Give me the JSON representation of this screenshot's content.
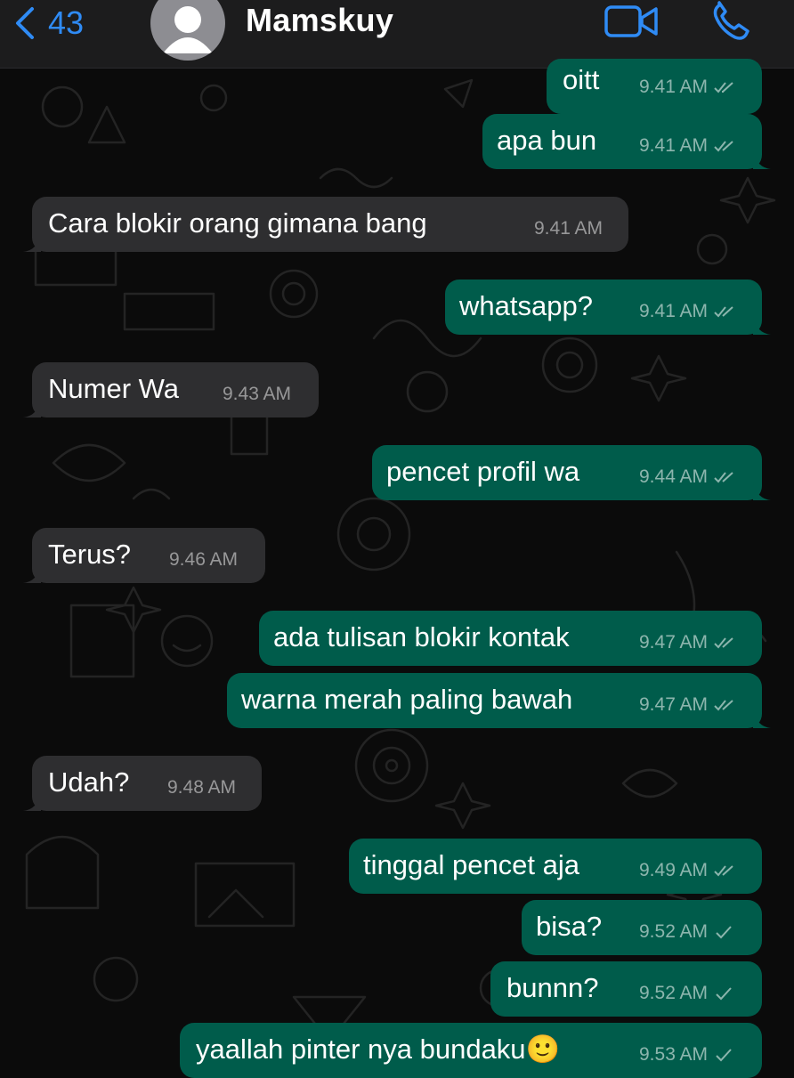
{
  "header": {
    "back_count": "43",
    "contact_name": "Mamskuy"
  },
  "messages": [
    {
      "text": "oitt",
      "time": "9.41 AM",
      "dir": "out",
      "status": "read"
    },
    {
      "text": "apa bun",
      "time": "9.41 AM",
      "dir": "out",
      "status": "read"
    },
    {
      "text": "Cara blokir orang gimana bang",
      "time": "9.41 AM",
      "dir": "in"
    },
    {
      "text": "whatsapp?",
      "time": "9.41 AM",
      "dir": "out",
      "status": "read"
    },
    {
      "text": "Numer Wa",
      "time": "9.43 AM",
      "dir": "in"
    },
    {
      "text": "pencet profil wa",
      "time": "9.44 AM",
      "dir": "out",
      "status": "read"
    },
    {
      "text": "Terus?",
      "time": "9.46 AM",
      "dir": "in"
    },
    {
      "text": "ada tulisan blokir kontak",
      "time": "9.47 AM",
      "dir": "out",
      "status": "read"
    },
    {
      "text": "warna merah paling bawah",
      "time": "9.47 AM",
      "dir": "out",
      "status": "read"
    },
    {
      "text": "Udah?",
      "time": "9.48 AM",
      "dir": "in"
    },
    {
      "text": "tinggal pencet aja",
      "time": "9.49 AM",
      "dir": "out",
      "status": "read"
    },
    {
      "text": "bisa?",
      "time": "9.52 AM",
      "dir": "out",
      "status": "sent"
    },
    {
      "text": "bunnn?",
      "time": "9.52 AM",
      "dir": "out",
      "status": "sent"
    },
    {
      "text": "yaallah pinter nya bundaku🙂",
      "time": "9.53 AM",
      "dir": "out",
      "status": "sent"
    }
  ],
  "colors": {
    "accent": "#2f8bf5",
    "outgoing_bubble": "#005c4b",
    "incoming_bubble": "#2e2e30",
    "header": "#1c1c1d"
  },
  "icons": [
    "chevron-left-icon",
    "avatar-placeholder-icon",
    "video-call-icon",
    "phone-call-icon",
    "double-check-icon",
    "single-check-icon"
  ]
}
